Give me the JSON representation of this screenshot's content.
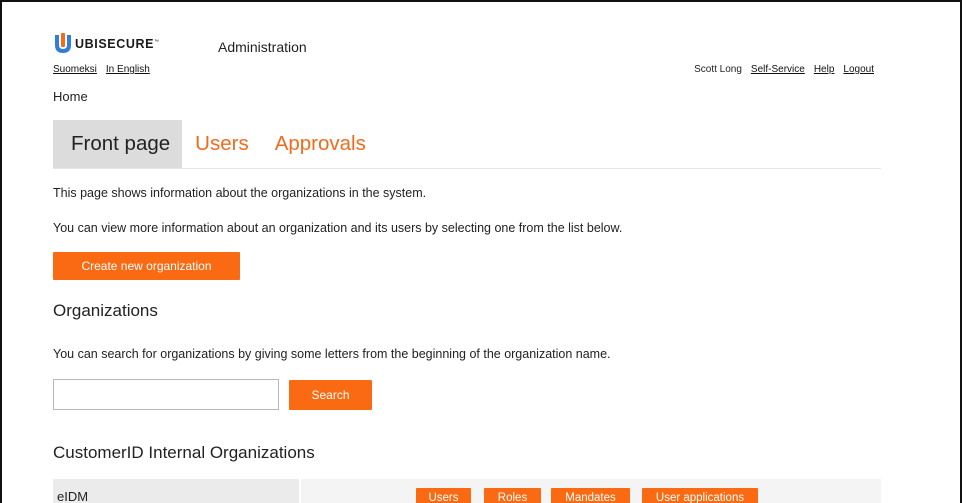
{
  "header": {
    "logo_text": "UBISECURE",
    "logo_tm": "™",
    "app_title": "Administration",
    "languages": [
      "Suomeksi",
      "In English"
    ],
    "user_name": "Scott Long",
    "user_links": [
      "Self-Service",
      "Help",
      "Logout"
    ]
  },
  "breadcrumb": "Home",
  "tabs": [
    {
      "label": "Front page",
      "active": true
    },
    {
      "label": "Users",
      "active": false
    },
    {
      "label": "Approvals",
      "active": false
    }
  ],
  "main": {
    "intro_1": "This page shows information about the organizations in the system.",
    "intro_2": "You can view more information about an organization and its users by selecting one from the list below.",
    "create_button": "Create new organization",
    "organizations_title": "Organizations",
    "search_help": "You can search for organizations by giving some letters from the beginning of the organization name.",
    "search_value": "",
    "search_button": "Search",
    "internal_title": "CustomerID Internal Organizations",
    "org_rows": [
      {
        "name": "eIDM",
        "actions": [
          "Users",
          "Roles",
          "Mandates",
          "User applications"
        ]
      }
    ]
  },
  "colors": {
    "accent": "#f96a12",
    "tab_link": "#f26b1d",
    "active_tab_bg": "#dcdcdc",
    "logo_blue": "#2f7fd8"
  },
  "icons": {
    "logo": "ubisecure-u-logo-icon"
  }
}
